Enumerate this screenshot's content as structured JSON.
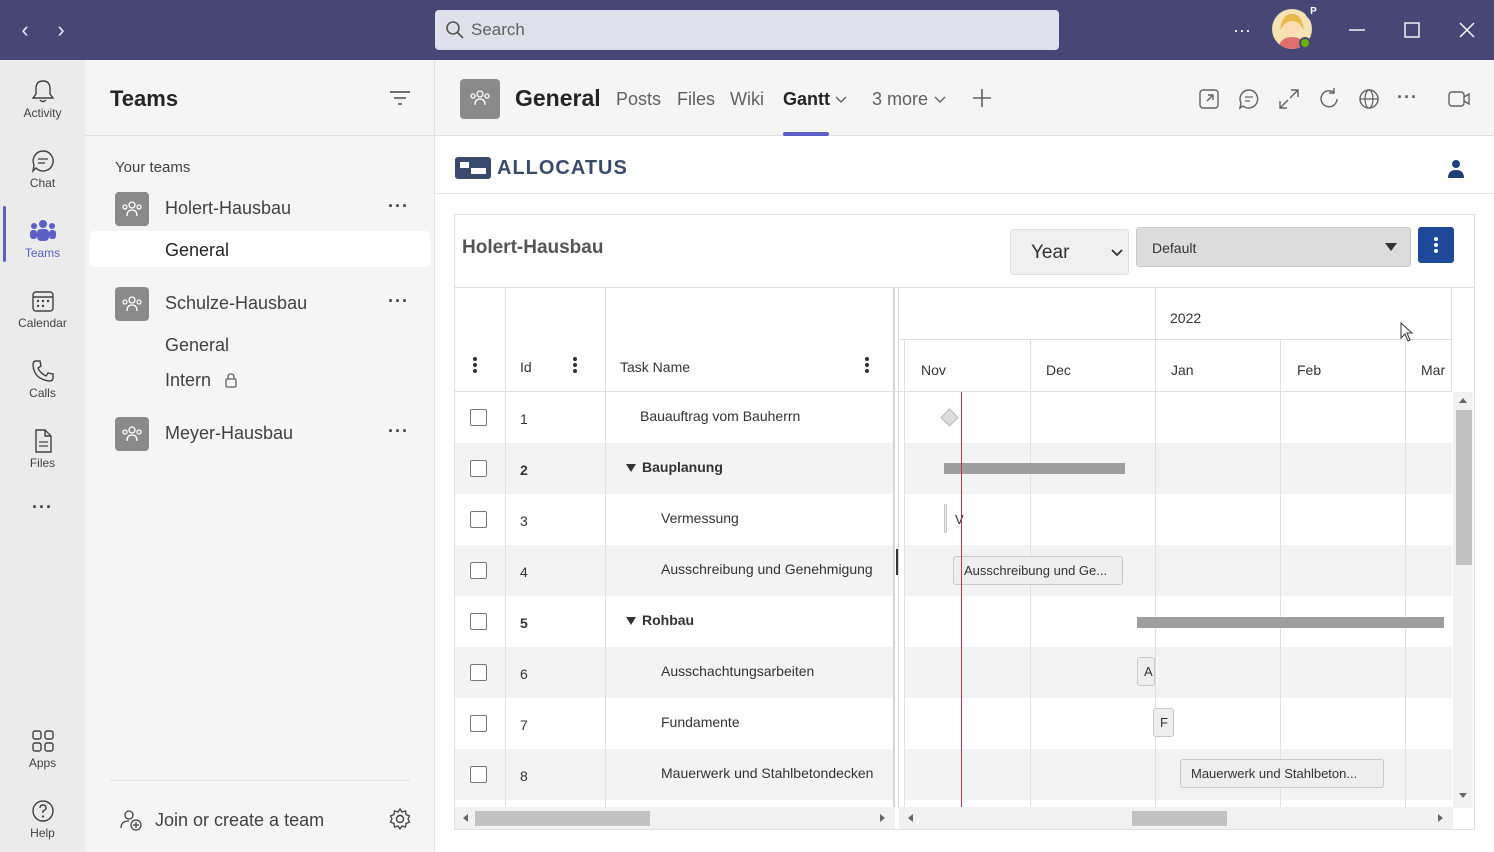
{
  "titlebar": {
    "search_placeholder": "Search",
    "more_label": "···",
    "avatar_badge": "P"
  },
  "rail": {
    "items": [
      {
        "label": "Activity"
      },
      {
        "label": "Chat"
      },
      {
        "label": "Teams"
      },
      {
        "label": "Calendar"
      },
      {
        "label": "Calls"
      },
      {
        "label": "Files"
      },
      {
        "label": "···"
      },
      {
        "label": "Apps"
      },
      {
        "label": "Help"
      }
    ]
  },
  "teams_panel": {
    "title": "Teams",
    "section_label": "Your teams",
    "teams": [
      {
        "name": "Holert-Hausbau",
        "channels": [
          "General"
        ]
      },
      {
        "name": "Schulze-Hausbau",
        "channels": [
          "General",
          "Intern"
        ]
      },
      {
        "name": "Meyer-Hausbau",
        "channels": []
      }
    ],
    "more": "···",
    "join_label": "Join or create a team"
  },
  "tabbar": {
    "channel_title": "General",
    "tabs": [
      "Posts",
      "Files",
      "Wiki",
      "Gantt",
      "3 more"
    ]
  },
  "app": {
    "logo_text": "ALLOCATUS",
    "project_title": "Holert-Hausbau",
    "view_select": "Year",
    "layout_select": "Default",
    "gantt": {
      "headers": {
        "id": "Id",
        "task_name": "Task Name"
      },
      "year_label": "2022",
      "months": [
        "Nov",
        "Dec",
        "Jan",
        "Feb",
        "Mar"
      ],
      "rows": [
        {
          "id": "1",
          "name": "Bauauftrag vom Bauherrn",
          "bold": false,
          "summary": false,
          "level": 1
        },
        {
          "id": "2",
          "name": "Bauplanung",
          "bold": true,
          "summary": true,
          "level": 0
        },
        {
          "id": "3",
          "name": "Vermessung",
          "bold": false,
          "summary": false,
          "level": 2
        },
        {
          "id": "4",
          "name": "Ausschreibung und Genehmigung",
          "bold": false,
          "summary": false,
          "level": 2
        },
        {
          "id": "5",
          "name": "Rohbau",
          "bold": true,
          "summary": true,
          "level": 0
        },
        {
          "id": "6",
          "name": "Ausschachtungsarbeiten",
          "bold": false,
          "summary": false,
          "level": 2
        },
        {
          "id": "7",
          "name": "Fundamente",
          "bold": false,
          "summary": false,
          "level": 2
        },
        {
          "id": "8",
          "name": "Mauerwerk und Stahlbetondecken",
          "bold": false,
          "summary": false,
          "level": 2
        }
      ],
      "bar_labels": {
        "r3": "V",
        "r4": "Ausschreibung und Ge...",
        "r6": "A",
        "r7": "F",
        "r8": "Mauerwerk und Stahlbeton..."
      }
    }
  },
  "colors": {
    "titlebar": "#464775",
    "accent": "#5b5fc7",
    "menu_button": "#1f4a9b",
    "today_line": "#c4314b"
  }
}
